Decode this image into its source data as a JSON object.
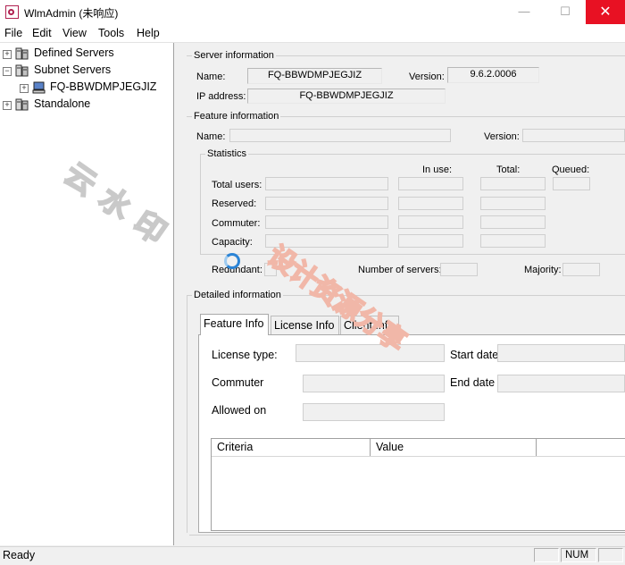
{
  "window": {
    "title": "WlmAdmin (未响应)",
    "controls": {
      "minimize": "—",
      "maximize": "☐",
      "close": "✕"
    }
  },
  "menu": [
    "File",
    "Edit",
    "View",
    "Tools",
    "Help"
  ],
  "tree": [
    {
      "label": "Defined Servers",
      "expander": "+",
      "icon": "server-group-icon"
    },
    {
      "label": "Subnet Servers",
      "expander": "−",
      "icon": "server-group-icon"
    },
    {
      "label": "FQ-BBWDMPJEGJIZ",
      "expander": "+",
      "icon": "computer-icon"
    },
    {
      "label": "Standalone",
      "expander": "+",
      "icon": "server-group-icon"
    }
  ],
  "server_info": {
    "group_label": "Server information",
    "name_label": "Name:",
    "name_value": "FQ-BBWDMPJEGJIZ",
    "version_label": "Version:",
    "version_value": "9.6.2.0006",
    "ip_label": "IP address:",
    "ip_value": "FQ-BBWDMPJEGJIZ"
  },
  "feature_info": {
    "group_label": "Feature information",
    "name_label": "Name:",
    "version_label": "Version:",
    "statistics": {
      "group_label": "Statistics",
      "in_use": "In use:",
      "total": "Total:",
      "queued": "Queued:",
      "rows": [
        "Total users:",
        "Reserved:",
        "Commuter:",
        "Capacity:"
      ]
    },
    "redundant_label": "Redundant:",
    "num_servers_label": "Number of servers:",
    "majority_label": "Majority:"
  },
  "detailed_info": {
    "group_label": "Detailed information",
    "tabs": [
      "Feature Info",
      "License Info",
      "Client Info"
    ],
    "license_type": "License type:",
    "start_date": "Start date",
    "commuter": "Commuter",
    "end_date": "End date",
    "allowed_on": "Allowed on",
    "columns": [
      "Criteria",
      "Value"
    ]
  },
  "status": {
    "text": "Ready",
    "num": "NUM"
  },
  "watermark": {
    "part1": "云 水 印",
    "part2": "设计资源分享"
  },
  "colors": {
    "close": "#e81123",
    "spinner": "#2b84d6"
  }
}
